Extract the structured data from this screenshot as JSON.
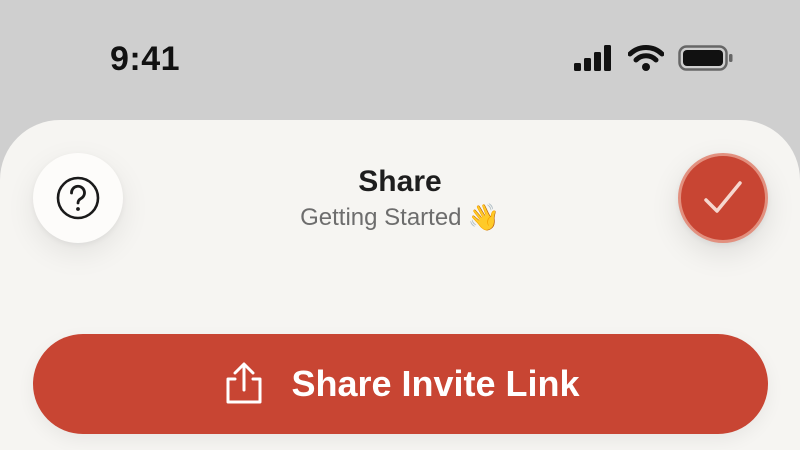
{
  "status_bar": {
    "time": "9:41",
    "icons": [
      "cellular-signal-icon",
      "wifi-icon",
      "battery-icon"
    ]
  },
  "header": {
    "title": "Share",
    "subtitle": "Getting Started",
    "subtitle_emoji": "👋",
    "help_icon": "question-circle-icon",
    "confirm_icon": "checkmark-icon"
  },
  "actions": {
    "share_label": "Share Invite Link",
    "share_icon": "share-upload-icon"
  },
  "colors": {
    "accent": "#c84533",
    "sheet_background": "#f6f5f2",
    "screen_background": "#cfcfcf"
  }
}
